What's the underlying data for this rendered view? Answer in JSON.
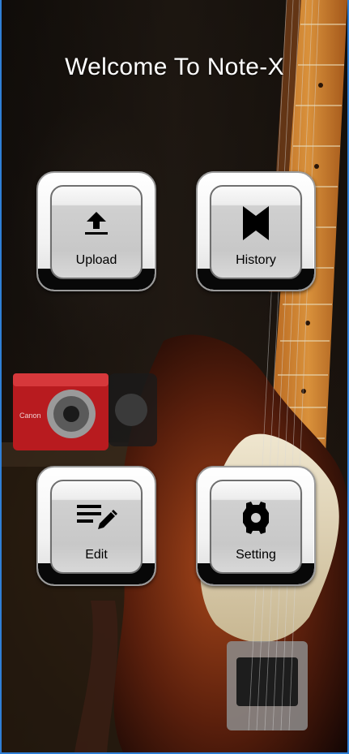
{
  "app": {
    "title": "Welcome To Note-X"
  },
  "tiles": [
    {
      "id": "upload",
      "label": "Upload",
      "icon": "upload-icon"
    },
    {
      "id": "history",
      "label": "History",
      "icon": "bookmark-icon"
    },
    {
      "id": "edit",
      "label": "Edit",
      "icon": "edit-notes-icon"
    },
    {
      "id": "setting",
      "label": "Setting",
      "icon": "settings-icon"
    }
  ],
  "background": {
    "description_icon": "guitar-and-camera-photo",
    "camera_brand": "Canon"
  },
  "colors": {
    "frame_accent": "#2f7fd6",
    "title_text": "#ffffff",
    "tile_base": "#080808"
  }
}
